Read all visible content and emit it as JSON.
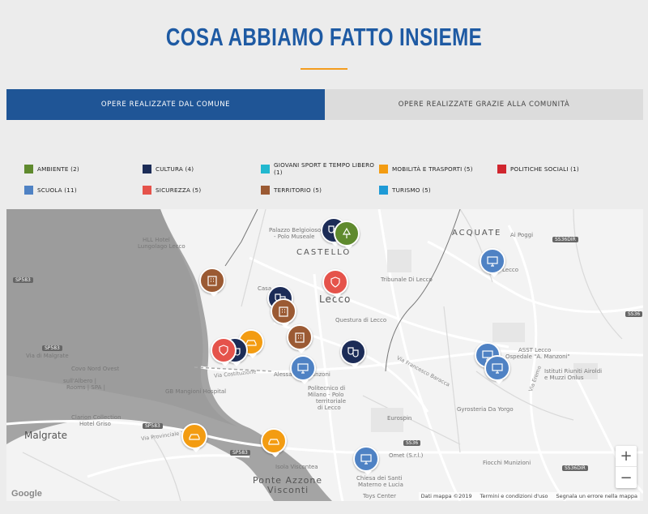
{
  "title": "COSA ABBIAMO FATTO INSIEME",
  "tabs": [
    {
      "label": "OPERE REALIZZATE DAL COMUNE"
    },
    {
      "label": "OPERE REALIZZATE GRAZIE ALLA COMUNITÀ"
    }
  ],
  "legend": [
    {
      "label": "AMBIENTE (2)",
      "color": "#5f8a2e"
    },
    {
      "label": "CULTURA (4)",
      "color": "#1c2c57"
    },
    {
      "label": "GIOVANI SPORT E TEMPO LIBERO (1)",
      "color": "#22b8cf"
    },
    {
      "label": "MOBILITÀ E TRASPORTI (5)",
      "color": "#f39c12"
    },
    {
      "label": "POLITICHE SOCIALI (1)",
      "color": "#d0262e"
    },
    {
      "label": "SCUOLA (11)",
      "color": "#4f82c4"
    },
    {
      "label": "SICUREZZA (5)",
      "color": "#e5534b"
    },
    {
      "label": "TERRITORIO (5)",
      "color": "#9b5a33"
    },
    {
      "label": "TURISMO (5)",
      "color": "#1e9ad6"
    }
  ],
  "map": {
    "labels": {
      "castello": "CASTELLO",
      "acquate": "ACQUATE",
      "lecco": "Lecco",
      "malgrate": "Malgrate",
      "ponte": "Ponte Azzone",
      "visconti": "Visconti",
      "via_malgrate": "Via di Malgrate",
      "hll_hotel": "HLL Hotel",
      "lungolago": "Lungolago Lecco",
      "palazzo": "Palazzo Belgioioso",
      "polo_museale": "- Polo Museale",
      "tribunale": "Tribunale Di Lecco",
      "questura": "Questura di Lecco",
      "casa": "Casa",
      "coca_nord": "Covo Nord Ovest",
      "sull_albero": "sull'Albero |",
      "rooms": "Rooms | SPA |",
      "gb_mangioni": "GB Mangioni Hospital",
      "clarion": "Clarion Collection",
      "hotel": "Hotel Griso",
      "via_provincia": "Via Provinciale",
      "via_costituzione": "Via Costituzione",
      "politecnico": "Politecnico di",
      "milano_polo": "Milano - Polo",
      "territoriale": "territoriale",
      "di_lecco": "di Lecco",
      "eurospin": "Eurospin",
      "omet": "Omet (S.r.l.)",
      "fiocchi": "Fiocchi Munizioni",
      "chiesa": "Chiesa dei Santi",
      "materno": "Materno e Lucia",
      "toys": "Toys Center",
      "isola": "Isola Viscontea",
      "asst": "ASST Lecco",
      "ospedale": "Ospedale \"A. Manzoni\"",
      "istituti": "Istituti Riuniti Airoldi",
      "muzzi": "e Muzzi Onlus",
      "gyrosteria": "Gyrosteria Da Yorgo",
      "poggi": "Ai Poggi",
      "via_ermo": "Via Eremo",
      "via_francesco": "Via Francesco Baracca",
      "alessandro": "Alessandro Manzoni",
      "lecco_small": "Lecco",
      "sp583": "SP583",
      "ss36": "SS36",
      "ss36dir": "SS36DIR"
    },
    "zoom_in": "+",
    "zoom_out": "−",
    "attribution": [
      "Dati mappa ©2019",
      "Termini e condizioni d'uso",
      "Segnala un errore nella mappa"
    ],
    "logo": "Google"
  }
}
